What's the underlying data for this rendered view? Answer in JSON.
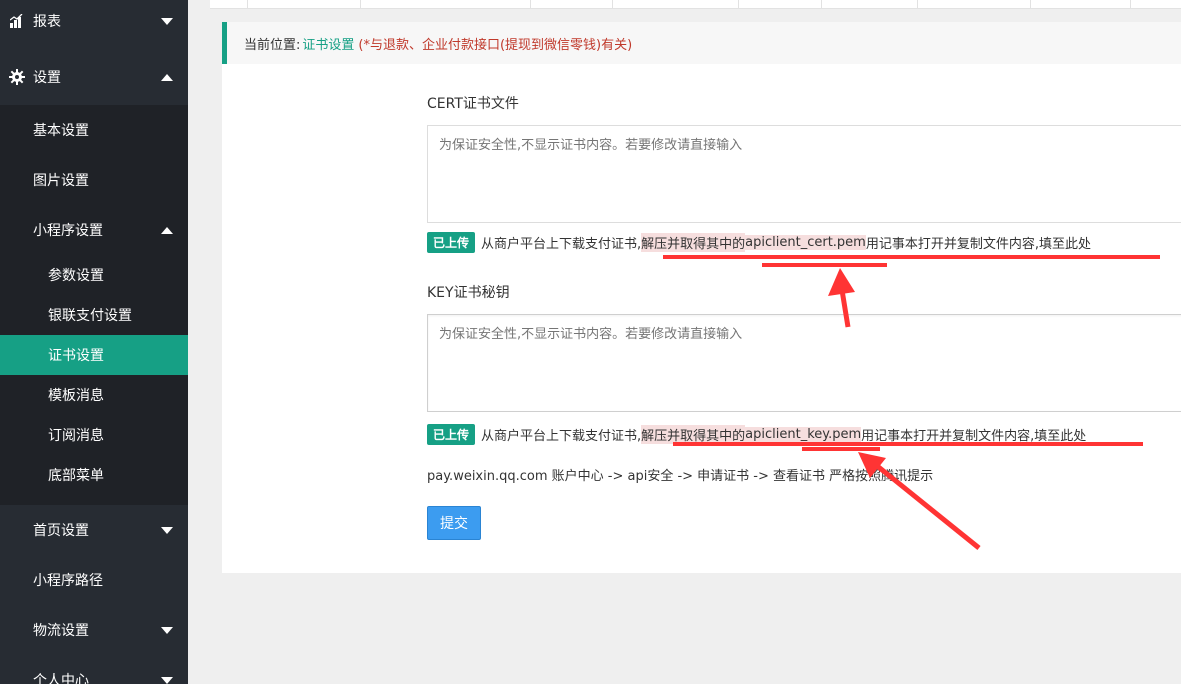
{
  "sidebar": {
    "reports": "报表",
    "settings": "设置",
    "settings_items": {
      "basic": "基本设置",
      "image": "图片设置",
      "miniprogram": "小程序设置",
      "miniprogram_items": {
        "params": "参数设置",
        "unionpay": "银联支付设置",
        "cert": "证书设置",
        "template": "模板消息",
        "subscribe": "订阅消息",
        "bottom_menu": "底部菜单"
      }
    },
    "home_settings": "首页设置",
    "miniprogram_path": "小程序路径",
    "logistics": "物流设置",
    "personal_center": "个人中心"
  },
  "breadcrumb": {
    "prefix": "当前位置:",
    "current": "证书设置",
    "note": "(*与退款、企业付款接口(提现到微信零钱)有关)"
  },
  "cert": {
    "label": "CERT证书文件",
    "placeholder": "为保证安全性,不显示证书内容。若要修改请直接输入",
    "badge": "已上传",
    "hint_before": "从商户平台上下载支付证书,",
    "hint_mid_a": "解压并取得其中的",
    "hint_file": "apiclient_cert.pem",
    "hint_after": "用记事本打开并复制文件内容,填至此处"
  },
  "key": {
    "label": "KEY证书秘钥",
    "placeholder": "为保证安全性,不显示证书内容。若要修改请直接输入",
    "badge": "已上传",
    "hint_before": "从商户平台上下载支付证书,",
    "hint_mid_a": "解压并取得其中的",
    "hint_file": "apiclient_key.pem",
    "hint_after": "用记事本打开并复制文件内容,填至此处"
  },
  "path_info": "pay.weixin.qq.com  账户中心 -> api安全 -> 申请证书 -> 查看证书   严格按照腾讯提示",
  "submit_label": "提交",
  "colors": {
    "sidebar_bg": "#272c33",
    "sidebar_sub_bg": "#1f2227",
    "accent": "#16a085",
    "button": "#3c9cf0",
    "annotation": "#ff3434"
  }
}
